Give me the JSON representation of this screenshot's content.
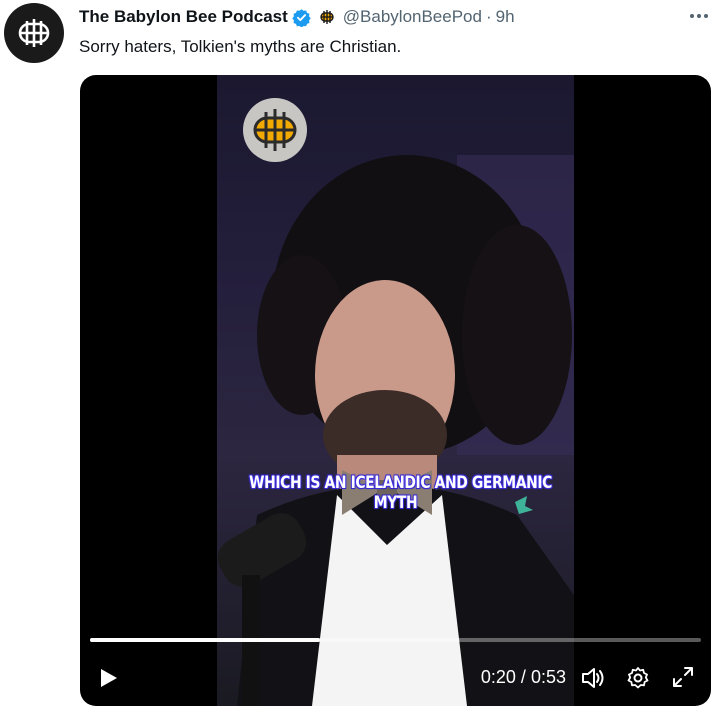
{
  "tweet": {
    "author": {
      "display_name": "The Babylon Bee Podcast",
      "handle": "@BabylonBeePod",
      "verified": true,
      "avatar_icon": "babylon-bee-logo-icon",
      "affiliate_badge_icon": "babylon-bee-badge-icon"
    },
    "separator": "·",
    "timestamp": "9h",
    "text": "Sorry haters, Tolkien's myths are Christian.",
    "more_icon": "more-options-icon"
  },
  "video": {
    "caption_lines": [
      "WHICH IS AN ICELANDIC AND GERMANIC",
      "MYTH"
    ],
    "watermark_icon": "babylon-bee-logo-icon",
    "progress_fraction": 0.377,
    "current_time": "0:20",
    "time_separator": "/",
    "duration": "0:53",
    "controls": {
      "play_icon": "play-icon",
      "volume_icon": "volume-icon",
      "settings_icon": "settings-gear-icon",
      "fullscreen_icon": "fullscreen-icon"
    }
  },
  "colors": {
    "verified_blue": "#1d9bf0",
    "secondary_text": "#536471",
    "primary_text": "#0f1419",
    "caption_glow": "#4b3cff"
  }
}
